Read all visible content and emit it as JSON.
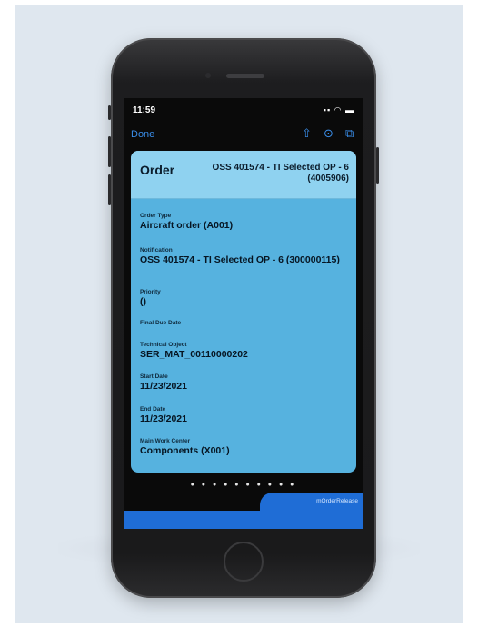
{
  "status_bar": {
    "time": "11:59",
    "icons": "▪▪ ◠ ▬"
  },
  "toolbar": {
    "done_label": "Done",
    "icons": [
      "share-icon",
      "sync-icon",
      "edit-icon"
    ],
    "share_glyph": "⇧",
    "sync_glyph": "⊙",
    "edit_glyph": "⧉"
  },
  "card": {
    "title": "Order",
    "subtitle": "OSS 401574 - TI Selected OP - 6 (4005906)",
    "fields": [
      {
        "label": "Order Type",
        "value": "Aircraft order (A001)"
      },
      {
        "label": "Notification",
        "value": "OSS 401574 - TI Selected OP - 6 (300000115)"
      },
      {
        "label": "Priority",
        "value": "()"
      },
      {
        "label": "Final Due Date",
        "value": ""
      },
      {
        "label": "Technical Object",
        "value": "SER_MAT_00110000202"
      },
      {
        "label": "Start Date",
        "value": "11/23/2021"
      },
      {
        "label": "End Date",
        "value": "11/23/2021"
      },
      {
        "label": "Main Work Center",
        "value": "Components (X001)"
      }
    ]
  },
  "page_indicator": {
    "dots": "● ● ● ● ● ● ● ● ● ●",
    "total": 10
  },
  "bottom_tab": {
    "label": "mOrderRelease"
  },
  "colors": {
    "card": "#56b2df",
    "card_header": "#8fd2f0",
    "accent": "#3a8eea",
    "bottom_bar": "#1f6dd6"
  }
}
